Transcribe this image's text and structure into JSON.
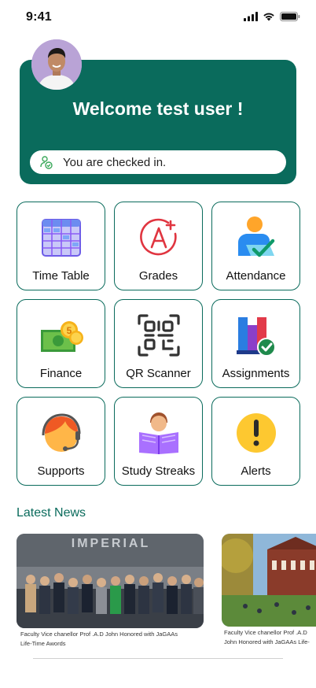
{
  "status_bar": {
    "time": "9:41"
  },
  "welcome": {
    "title": "Welcome test user !",
    "checkin_text": "You are checked in."
  },
  "tiles": [
    {
      "label": "Time Table",
      "icon": "calendar-grid-icon"
    },
    {
      "label": "Grades",
      "icon": "grade-a-plus-icon"
    },
    {
      "label": "Attendance",
      "icon": "person-check-icon"
    },
    {
      "label": "Finance",
      "icon": "money-coin-icon"
    },
    {
      "label": "QR Scanner",
      "icon": "qr-code-icon"
    },
    {
      "label": "Assignments",
      "icon": "books-check-icon"
    },
    {
      "label": "Supports",
      "icon": "headset-agent-icon"
    },
    {
      "label": "Study Streaks",
      "icon": "reading-person-icon"
    },
    {
      "label": "Alerts",
      "icon": "exclamation-icon"
    }
  ],
  "news": {
    "heading": "Latest News",
    "items": [
      {
        "caption": "Faculty Vice chanellor Prof .A.D John Honored with JaGAAs Life-Time Awords",
        "sign_text": "IMPERIAL"
      },
      {
        "caption": "Faculty Vice chanellor Prof .A.D John Honored with JaGAAs Life-Time Awords"
      }
    ]
  },
  "colors": {
    "primary": "#0a6b5c",
    "tile_border": "#0a6b5c"
  }
}
